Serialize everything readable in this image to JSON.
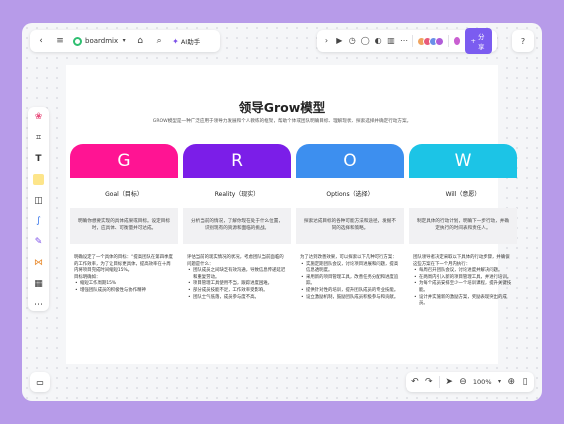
{
  "toolbar": {
    "app_name": "boardmix",
    "ai_label": "AI助手",
    "share_label": "分享",
    "avatar_colors": [
      "#f0a35e",
      "#e85a7a",
      "#6a8ee8",
      "#b05cd8"
    ]
  },
  "board": {
    "title": "领导Grow模型",
    "subtitle": "GROW模型是一种广泛应用于领导力发展和个人教练的框架，帮助个体或团队明确目标、理解现状、探索选择并确定行动方案。",
    "columns": [
      {
        "letter": "G",
        "color": "#ff1493",
        "name": "Goal（目标）",
        "desc": "明确你想要实现的具体成果或目标。设定目标时，应具体、可衡量并可达成。",
        "body_intro": "明确设定了一个具体的目标：“提高团队在第四季度的工作效率，为了让目标更具体，提高效率在十周内将项目完成时间缩短15%。",
        "body_sub": "目标明确如：",
        "bullets": [
          "缩短工作周期15%",
          "增强团队成员的积极性与协作精神"
        ]
      },
      {
        "letter": "R",
        "color": "#7b1ee8",
        "name": "Reality（现实）",
        "desc": "分析当前的情况，了解你现在处于什么位置，识别现有的资源和面临的挑战。",
        "body_intro": "评估当前的现实情况的状况，考虑团队当前面临的问题是什么：",
        "body_sub": "",
        "bullets": [
          "团队成员之间缺乏有效沟通，导致信息传递延迟和重复劳动。",
          "项目管理工具使用不当，跟踪进度困难。",
          "部分成员技能不足，工作效率受影响。",
          "团队士气低落，成员参与度不高。"
        ]
      },
      {
        "letter": "O",
        "color": "#3d8fef",
        "name": "Options（选择）",
        "desc": "探索达成目标的各种可能方法和途径，发掘不同的选择和策略。",
        "body_intro": "为了达到改善效果，可以探索以下几种可行方案：",
        "body_sub": "",
        "bullets": [
          "实施定期团队会议，讨论项目进展和问题，提高信息透明度。",
          "采用新的项目管理工具，改善任务分配和进度追踪。",
          "提供针对性的培训，提升团队成员的专业技能。",
          "设立激励机制，鼓励团队成员积极参与和贡献。"
        ]
      },
      {
        "letter": "W",
        "color": "#1cc4e6",
        "name": "Will（意愿）",
        "desc": "制定具体的行动计划，明确下一步行动，并确定执行的时间表和责任人。",
        "body_intro": "团队领导者决定采取以下具体的行动步骤，并确保这些方案在下一个月内执行：",
        "body_sub": "",
        "bullets": [
          "每周召开团队会议，讨论进度并解决问题。",
          "在两周内引入新的项目管理工具，并进行培训。",
          "为每个成员安排至少一个培训课程，提升关键技能。",
          "设计并实施新的激励方案，奖励表现突出的成员。"
        ]
      }
    ]
  },
  "bottombar": {
    "zoom": "100%"
  }
}
